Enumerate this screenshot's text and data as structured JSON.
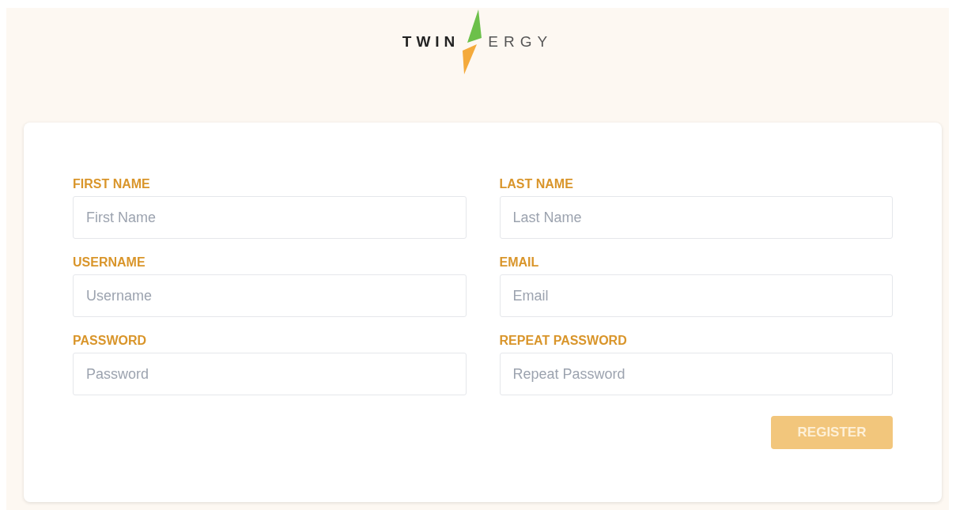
{
  "logo": {
    "left": "TWIN",
    "right": "ERGY"
  },
  "form": {
    "fields": [
      {
        "label": "FIRST NAME",
        "placeholder": "First Name"
      },
      {
        "label": "LAST NAME",
        "placeholder": "Last Name"
      },
      {
        "label": "USERNAME",
        "placeholder": "Username"
      },
      {
        "label": "EMAIL",
        "placeholder": "Email"
      },
      {
        "label": "PASSWORD",
        "placeholder": "Password"
      },
      {
        "label": "REPEAT PASSWORD",
        "placeholder": "Repeat Password"
      }
    ],
    "submit": {
      "label": "REGISTER",
      "disabled": true
    }
  }
}
